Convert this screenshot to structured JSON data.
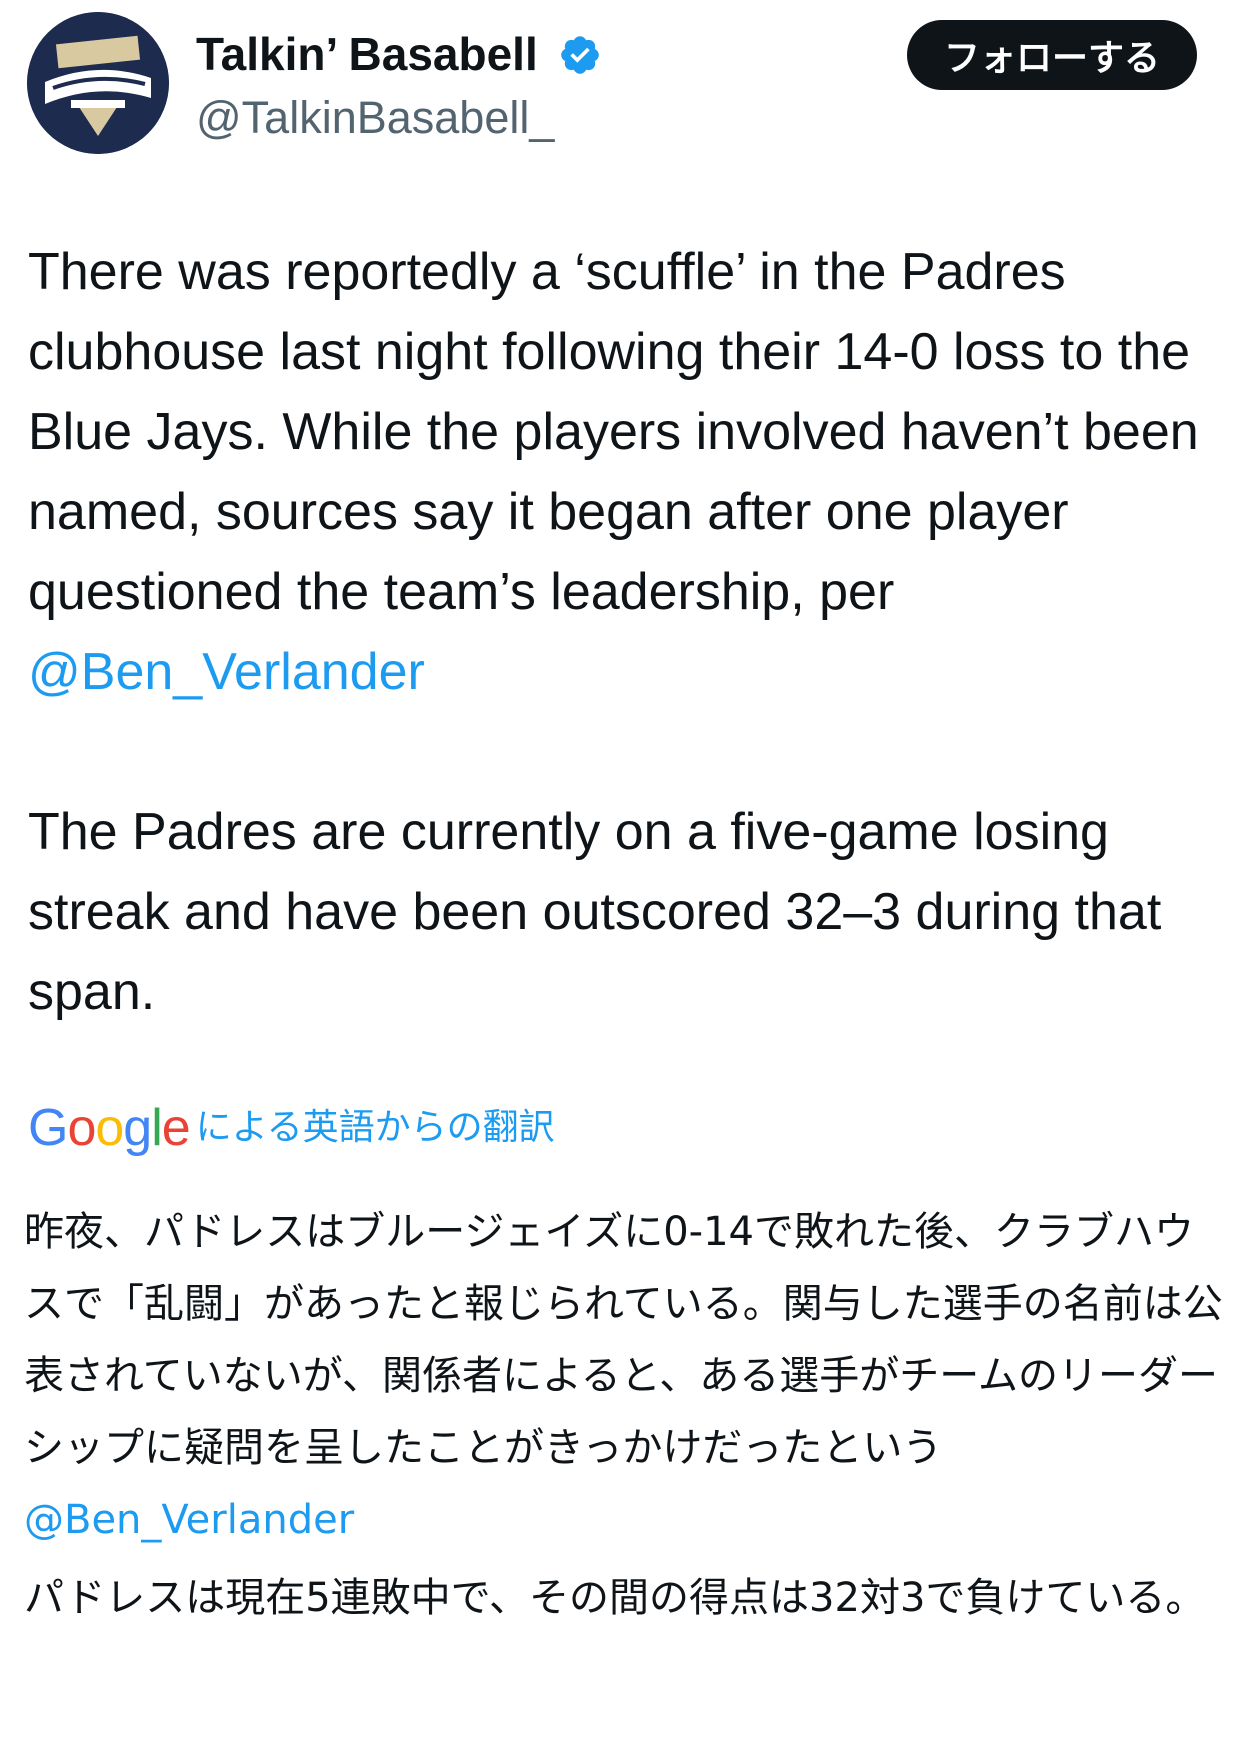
{
  "tweet": {
    "avatar_icon": "talkin-basabell-logo-icon",
    "display_name": "Talkin’ Basabell",
    "verified_icon": "verified-badge-icon",
    "handle": "@TalkinBasabell_",
    "follow_label": "フォローする",
    "body": {
      "p1_text": "There was reportedly a ‘scuffle’ in the Padres clubhouse last night following their 14-0 loss to the Blue Jays. While the players involved haven’t been named, sources say it began after one player questioned the team’s leadership, per ",
      "p1_mention": "@Ben_Verlander",
      "p2_text": "The Padres are currently on a five-game losing streak and have been outscored 32–3 during that span."
    },
    "translation": {
      "google_logo_text": "Google",
      "provider_label": "による英語からの翻訳",
      "p1_text": "昨夜、パドレスはブルージェイズに0-14で敗れた後、クラブハウスで「乱闘」があったと報じられている。関与した選手の名前は公表されていないが、関係者によると、ある選手がチームのリーダーシップに疑問を呈したことがきっかけだったという ",
      "p1_mention": "@Ben_Verlander",
      "p2_text": "パドレスは現在5連敗中で、その間の得点は32対3で負けている。"
    },
    "colors": {
      "text": "#0f1419",
      "secondary": "#536471",
      "link": "#1d9bf0",
      "follow_bg": "#0f1419"
    }
  }
}
